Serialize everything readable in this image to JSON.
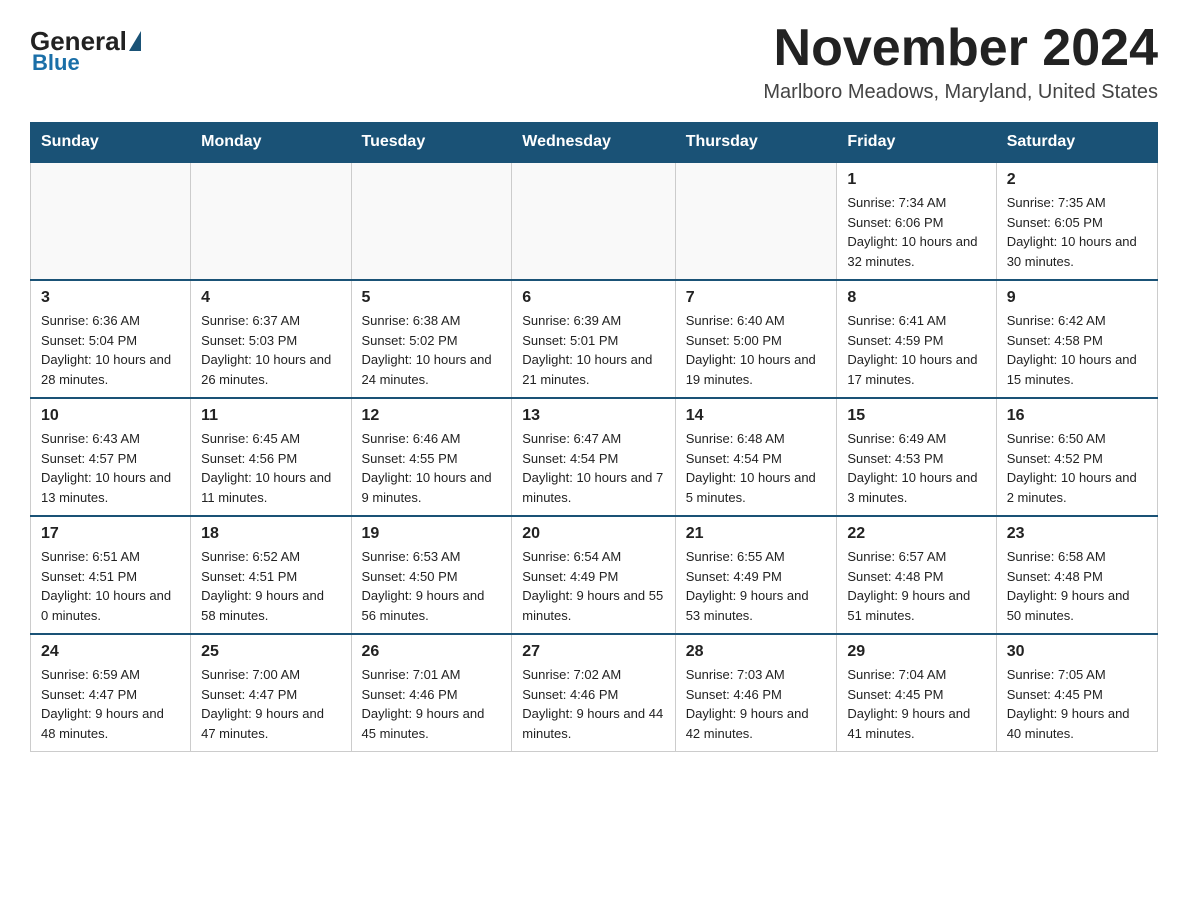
{
  "logo": {
    "general": "General",
    "blue": "Blue"
  },
  "header": {
    "month_title": "November 2024",
    "location": "Marlboro Meadows, Maryland, United States"
  },
  "weekdays": [
    "Sunday",
    "Monday",
    "Tuesday",
    "Wednesday",
    "Thursday",
    "Friday",
    "Saturday"
  ],
  "weeks": [
    [
      {
        "day": "",
        "sunrise": "",
        "sunset": "",
        "daylight": "",
        "empty": true
      },
      {
        "day": "",
        "sunrise": "",
        "sunset": "",
        "daylight": "",
        "empty": true
      },
      {
        "day": "",
        "sunrise": "",
        "sunset": "",
        "daylight": "",
        "empty": true
      },
      {
        "day": "",
        "sunrise": "",
        "sunset": "",
        "daylight": "",
        "empty": true
      },
      {
        "day": "",
        "sunrise": "",
        "sunset": "",
        "daylight": "",
        "empty": true
      },
      {
        "day": "1",
        "sunrise": "Sunrise: 7:34 AM",
        "sunset": "Sunset: 6:06 PM",
        "daylight": "Daylight: 10 hours and 32 minutes.",
        "empty": false
      },
      {
        "day": "2",
        "sunrise": "Sunrise: 7:35 AM",
        "sunset": "Sunset: 6:05 PM",
        "daylight": "Daylight: 10 hours and 30 minutes.",
        "empty": false
      }
    ],
    [
      {
        "day": "3",
        "sunrise": "Sunrise: 6:36 AM",
        "sunset": "Sunset: 5:04 PM",
        "daylight": "Daylight: 10 hours and 28 minutes.",
        "empty": false
      },
      {
        "day": "4",
        "sunrise": "Sunrise: 6:37 AM",
        "sunset": "Sunset: 5:03 PM",
        "daylight": "Daylight: 10 hours and 26 minutes.",
        "empty": false
      },
      {
        "day": "5",
        "sunrise": "Sunrise: 6:38 AM",
        "sunset": "Sunset: 5:02 PM",
        "daylight": "Daylight: 10 hours and 24 minutes.",
        "empty": false
      },
      {
        "day": "6",
        "sunrise": "Sunrise: 6:39 AM",
        "sunset": "Sunset: 5:01 PM",
        "daylight": "Daylight: 10 hours and 21 minutes.",
        "empty": false
      },
      {
        "day": "7",
        "sunrise": "Sunrise: 6:40 AM",
        "sunset": "Sunset: 5:00 PM",
        "daylight": "Daylight: 10 hours and 19 minutes.",
        "empty": false
      },
      {
        "day": "8",
        "sunrise": "Sunrise: 6:41 AM",
        "sunset": "Sunset: 4:59 PM",
        "daylight": "Daylight: 10 hours and 17 minutes.",
        "empty": false
      },
      {
        "day": "9",
        "sunrise": "Sunrise: 6:42 AM",
        "sunset": "Sunset: 4:58 PM",
        "daylight": "Daylight: 10 hours and 15 minutes.",
        "empty": false
      }
    ],
    [
      {
        "day": "10",
        "sunrise": "Sunrise: 6:43 AM",
        "sunset": "Sunset: 4:57 PM",
        "daylight": "Daylight: 10 hours and 13 minutes.",
        "empty": false
      },
      {
        "day": "11",
        "sunrise": "Sunrise: 6:45 AM",
        "sunset": "Sunset: 4:56 PM",
        "daylight": "Daylight: 10 hours and 11 minutes.",
        "empty": false
      },
      {
        "day": "12",
        "sunrise": "Sunrise: 6:46 AM",
        "sunset": "Sunset: 4:55 PM",
        "daylight": "Daylight: 10 hours and 9 minutes.",
        "empty": false
      },
      {
        "day": "13",
        "sunrise": "Sunrise: 6:47 AM",
        "sunset": "Sunset: 4:54 PM",
        "daylight": "Daylight: 10 hours and 7 minutes.",
        "empty": false
      },
      {
        "day": "14",
        "sunrise": "Sunrise: 6:48 AM",
        "sunset": "Sunset: 4:54 PM",
        "daylight": "Daylight: 10 hours and 5 minutes.",
        "empty": false
      },
      {
        "day": "15",
        "sunrise": "Sunrise: 6:49 AM",
        "sunset": "Sunset: 4:53 PM",
        "daylight": "Daylight: 10 hours and 3 minutes.",
        "empty": false
      },
      {
        "day": "16",
        "sunrise": "Sunrise: 6:50 AM",
        "sunset": "Sunset: 4:52 PM",
        "daylight": "Daylight: 10 hours and 2 minutes.",
        "empty": false
      }
    ],
    [
      {
        "day": "17",
        "sunrise": "Sunrise: 6:51 AM",
        "sunset": "Sunset: 4:51 PM",
        "daylight": "Daylight: 10 hours and 0 minutes.",
        "empty": false
      },
      {
        "day": "18",
        "sunrise": "Sunrise: 6:52 AM",
        "sunset": "Sunset: 4:51 PM",
        "daylight": "Daylight: 9 hours and 58 minutes.",
        "empty": false
      },
      {
        "day": "19",
        "sunrise": "Sunrise: 6:53 AM",
        "sunset": "Sunset: 4:50 PM",
        "daylight": "Daylight: 9 hours and 56 minutes.",
        "empty": false
      },
      {
        "day": "20",
        "sunrise": "Sunrise: 6:54 AM",
        "sunset": "Sunset: 4:49 PM",
        "daylight": "Daylight: 9 hours and 55 minutes.",
        "empty": false
      },
      {
        "day": "21",
        "sunrise": "Sunrise: 6:55 AM",
        "sunset": "Sunset: 4:49 PM",
        "daylight": "Daylight: 9 hours and 53 minutes.",
        "empty": false
      },
      {
        "day": "22",
        "sunrise": "Sunrise: 6:57 AM",
        "sunset": "Sunset: 4:48 PM",
        "daylight": "Daylight: 9 hours and 51 minutes.",
        "empty": false
      },
      {
        "day": "23",
        "sunrise": "Sunrise: 6:58 AM",
        "sunset": "Sunset: 4:48 PM",
        "daylight": "Daylight: 9 hours and 50 minutes.",
        "empty": false
      }
    ],
    [
      {
        "day": "24",
        "sunrise": "Sunrise: 6:59 AM",
        "sunset": "Sunset: 4:47 PM",
        "daylight": "Daylight: 9 hours and 48 minutes.",
        "empty": false
      },
      {
        "day": "25",
        "sunrise": "Sunrise: 7:00 AM",
        "sunset": "Sunset: 4:47 PM",
        "daylight": "Daylight: 9 hours and 47 minutes.",
        "empty": false
      },
      {
        "day": "26",
        "sunrise": "Sunrise: 7:01 AM",
        "sunset": "Sunset: 4:46 PM",
        "daylight": "Daylight: 9 hours and 45 minutes.",
        "empty": false
      },
      {
        "day": "27",
        "sunrise": "Sunrise: 7:02 AM",
        "sunset": "Sunset: 4:46 PM",
        "daylight": "Daylight: 9 hours and 44 minutes.",
        "empty": false
      },
      {
        "day": "28",
        "sunrise": "Sunrise: 7:03 AM",
        "sunset": "Sunset: 4:46 PM",
        "daylight": "Daylight: 9 hours and 42 minutes.",
        "empty": false
      },
      {
        "day": "29",
        "sunrise": "Sunrise: 7:04 AM",
        "sunset": "Sunset: 4:45 PM",
        "daylight": "Daylight: 9 hours and 41 minutes.",
        "empty": false
      },
      {
        "day": "30",
        "sunrise": "Sunrise: 7:05 AM",
        "sunset": "Sunset: 4:45 PM",
        "daylight": "Daylight: 9 hours and 40 minutes.",
        "empty": false
      }
    ]
  ]
}
